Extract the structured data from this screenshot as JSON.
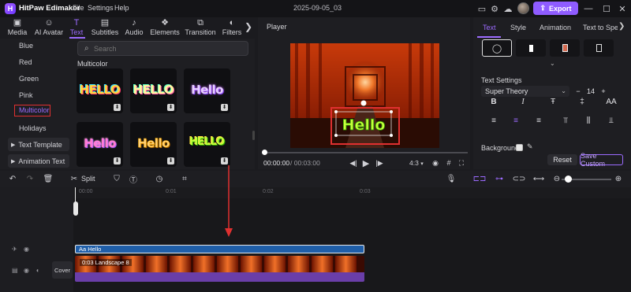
{
  "app": {
    "title": "HitPaw Edimakor",
    "menu": [
      "File",
      "Settings",
      "Help"
    ],
    "project_name": "2025-09-05_03",
    "export_label": "Export",
    "logo_glyph": "H"
  },
  "media_tabs": [
    {
      "label": "Media",
      "icon": "media-icon",
      "glyph": "▣"
    },
    {
      "label": "AI Avatar",
      "icon": "ai-avatar-icon",
      "glyph": "☺"
    },
    {
      "label": "Text",
      "icon": "text-icon",
      "glyph": "T"
    },
    {
      "label": "Subtitles",
      "icon": "subtitles-icon",
      "glyph": "▤"
    },
    {
      "label": "Audio",
      "icon": "audio-icon",
      "glyph": "♪"
    },
    {
      "label": "Elements",
      "icon": "elements-icon",
      "glyph": "❖"
    },
    {
      "label": "Transition",
      "icon": "transition-icon",
      "glyph": "⧉"
    },
    {
      "label": "Filters",
      "icon": "filters-icon",
      "glyph": "◐"
    }
  ],
  "categories": [
    "Blue",
    "Red",
    "Green",
    "Pink",
    "Multicolor",
    "Holidays"
  ],
  "category_groups": [
    "Text Template",
    "Animation Text"
  ],
  "search": {
    "placeholder": "Search"
  },
  "section_title": "Multicolor",
  "templates": [
    "Hello",
    "Hello",
    "Hello",
    "Hello",
    "Hello",
    "Hello"
  ],
  "template_first": "HELLO",
  "template_second": "HELLO",
  "template_fifth": "HELLO",
  "player": {
    "label": "Player",
    "time_current": "00:00:00",
    "time_total": "/ 00:03:00",
    "ratio": "4:3",
    "preview_text": "Hello"
  },
  "right_tabs": [
    "Text",
    "Style",
    "Animation",
    "Text to Speech"
  ],
  "text_settings": {
    "label": "Text Settings",
    "font": "Super Theory",
    "size": "14",
    "format_buttons": [
      "B",
      "I",
      "Ŧ",
      "‡",
      "AA"
    ],
    "background_label": "Background",
    "reset_label": "Reset",
    "save_custom_label": "Save Custom"
  },
  "timeline": {
    "split_label": "Split",
    "ruler": [
      "00:00",
      "0:01",
      "0:02",
      "0:03"
    ],
    "text_clip_label": "Aa Hello",
    "video_clip_label": "0:03  Landscape 8",
    "cover_label": "Cover"
  },
  "colors": {
    "accent": "#9c6bff",
    "export": "#8f5cff",
    "highlight_box": "#e03030",
    "text_clip": "#1f5ea8",
    "audio_bar": "#6a3ea8"
  }
}
